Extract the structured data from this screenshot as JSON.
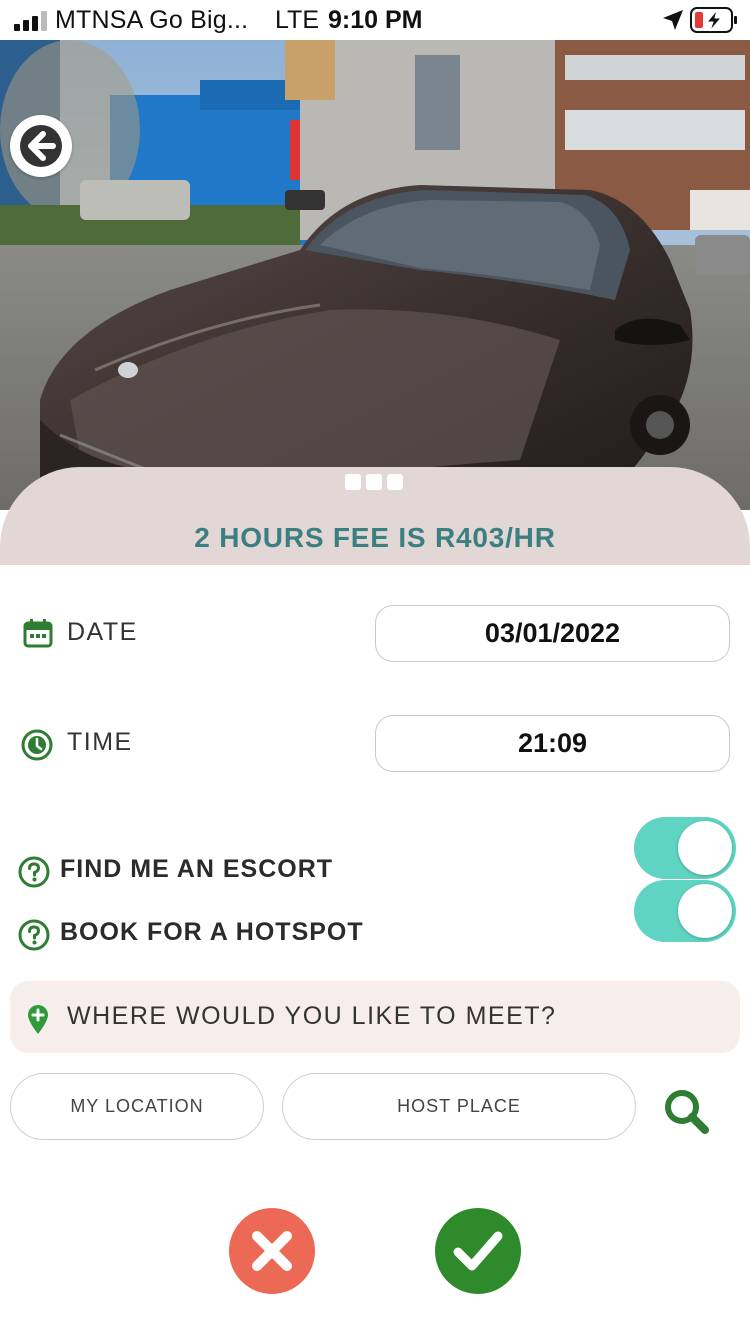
{
  "status_bar": {
    "carrier": "MTNSA Go Big...",
    "network": "LTE",
    "time": "9:10 PM"
  },
  "hero": {
    "carousel_pages": 3
  },
  "booking": {
    "fee_text": "2 HOURS FEE IS R403/HR",
    "date_label": "DATE",
    "date_value": "03/01/2022",
    "time_label": "TIME",
    "time_value": "21:09",
    "find_escort_label": "FIND ME AN ESCORT",
    "find_escort_on": true,
    "hotspot_label": "BOOK FOR A HOTSPOT",
    "hotspot_on": true,
    "meet_prompt": "WHERE WOULD YOU LIKE TO MEET?",
    "my_location_label": "MY LOCATION",
    "host_place_label": "HOST PLACE"
  },
  "colors": {
    "accent_teal": "#3b7f82",
    "toggle_on": "#5fd4c2",
    "icon_green": "#2e7d32",
    "cancel_red": "#ec6a55",
    "confirm_green": "#2e8a2a",
    "panel_bg": "#e2d7d5",
    "meet_bg": "#f7eeec"
  },
  "icons": {
    "back": "arrow-left-icon",
    "date": "calendar-icon",
    "time": "clock-icon",
    "help": "question-circle-icon",
    "location": "map-pin-plus-icon",
    "search": "search-icon",
    "cancel": "close-icon",
    "confirm": "check-icon"
  }
}
